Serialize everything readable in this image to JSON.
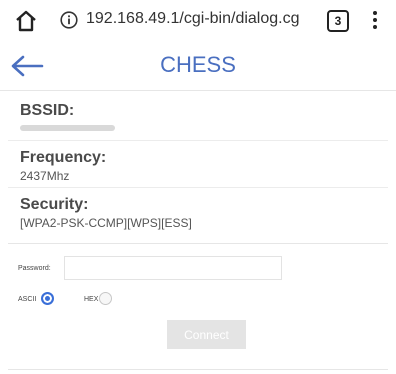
{
  "browser": {
    "url": "192.168.49.1/cgi-bin/dialog.cg",
    "tab_count": "3"
  },
  "header": {
    "title": "CHESS",
    "accent_color": "#4a6fc0"
  },
  "network": {
    "bssid_label": "BSSID:",
    "bssid_value": "",
    "frequency_label": "Frequency:",
    "frequency_value": "2437Mhz",
    "security_label": "Security:",
    "security_value": "[WPA2-PSK-CCMP][WPS][ESS]"
  },
  "form": {
    "password_label": "Password:",
    "password_value": "",
    "ascii_label": "ASCII",
    "hex_label": "HEX",
    "selected_encoding": "ascii",
    "connect_label": "Connect"
  },
  "icons": {
    "home": "home-icon",
    "info": "info-icon",
    "tabs": "tabs-icon",
    "menu": "more-vert-icon",
    "back": "arrow-left-icon"
  }
}
